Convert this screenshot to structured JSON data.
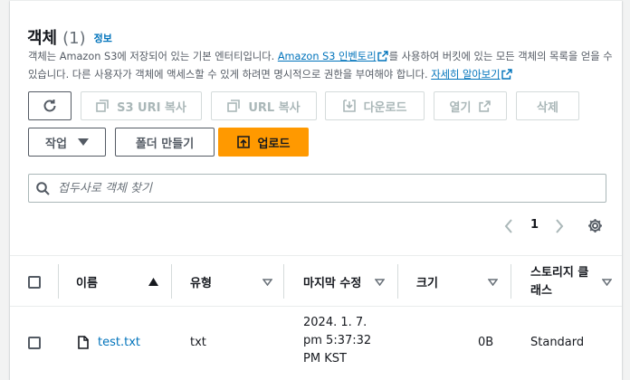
{
  "header": {
    "title": "객체",
    "count": "(1)",
    "info_link": "정보"
  },
  "description": {
    "line1_pre": "객체는 Amazon S3에 저장되어 있는 기본 엔터티입니다. ",
    "inventory_link": "Amazon S3 인벤토리",
    "line1_post": "를 사용하여 버킷에 있는 모든 객체의 목록을 얻을 수 있습니다. 다른 사용자가 객체에 액세스할 수 있게 하려면 명시적으로 권한을 부여해야 합니다. ",
    "learn_more_link": "자세히 알아보기"
  },
  "toolbar": {
    "copy_s3_uri": "S3 URI 복사",
    "copy_url": "URL 복사",
    "download": "다운로드",
    "open": "열기",
    "delete": "삭제",
    "actions": "작업",
    "create_folder": "폴더 만들기",
    "upload": "업로드"
  },
  "search": {
    "placeholder": "접두사로 객체 찾기"
  },
  "pagination": {
    "current_page": "1"
  },
  "table": {
    "columns": [
      "이름",
      "유형",
      "마지막 수정",
      "크기",
      "스토리지 클래스"
    ],
    "rows": [
      {
        "name": "test.txt",
        "type": "txt",
        "last_modified_lines": [
          "2024. 1. 7.",
          "pm 5:37:32",
          "PM KST"
        ],
        "size": "0B",
        "storage_class": "Standard"
      }
    ]
  },
  "colors": {
    "link": "#0073bb",
    "primary_button": "#ff9900",
    "border": "#545b64",
    "disabled": "#aab7b8"
  },
  "icons": [
    "refresh-icon",
    "copy-icon",
    "download-icon",
    "external-link-icon",
    "caret-down-icon",
    "upload-icon",
    "search-icon",
    "chevron-left-icon",
    "chevron-right-icon",
    "gear-icon",
    "sort-ascending-icon",
    "sort-icon",
    "file-icon"
  ]
}
